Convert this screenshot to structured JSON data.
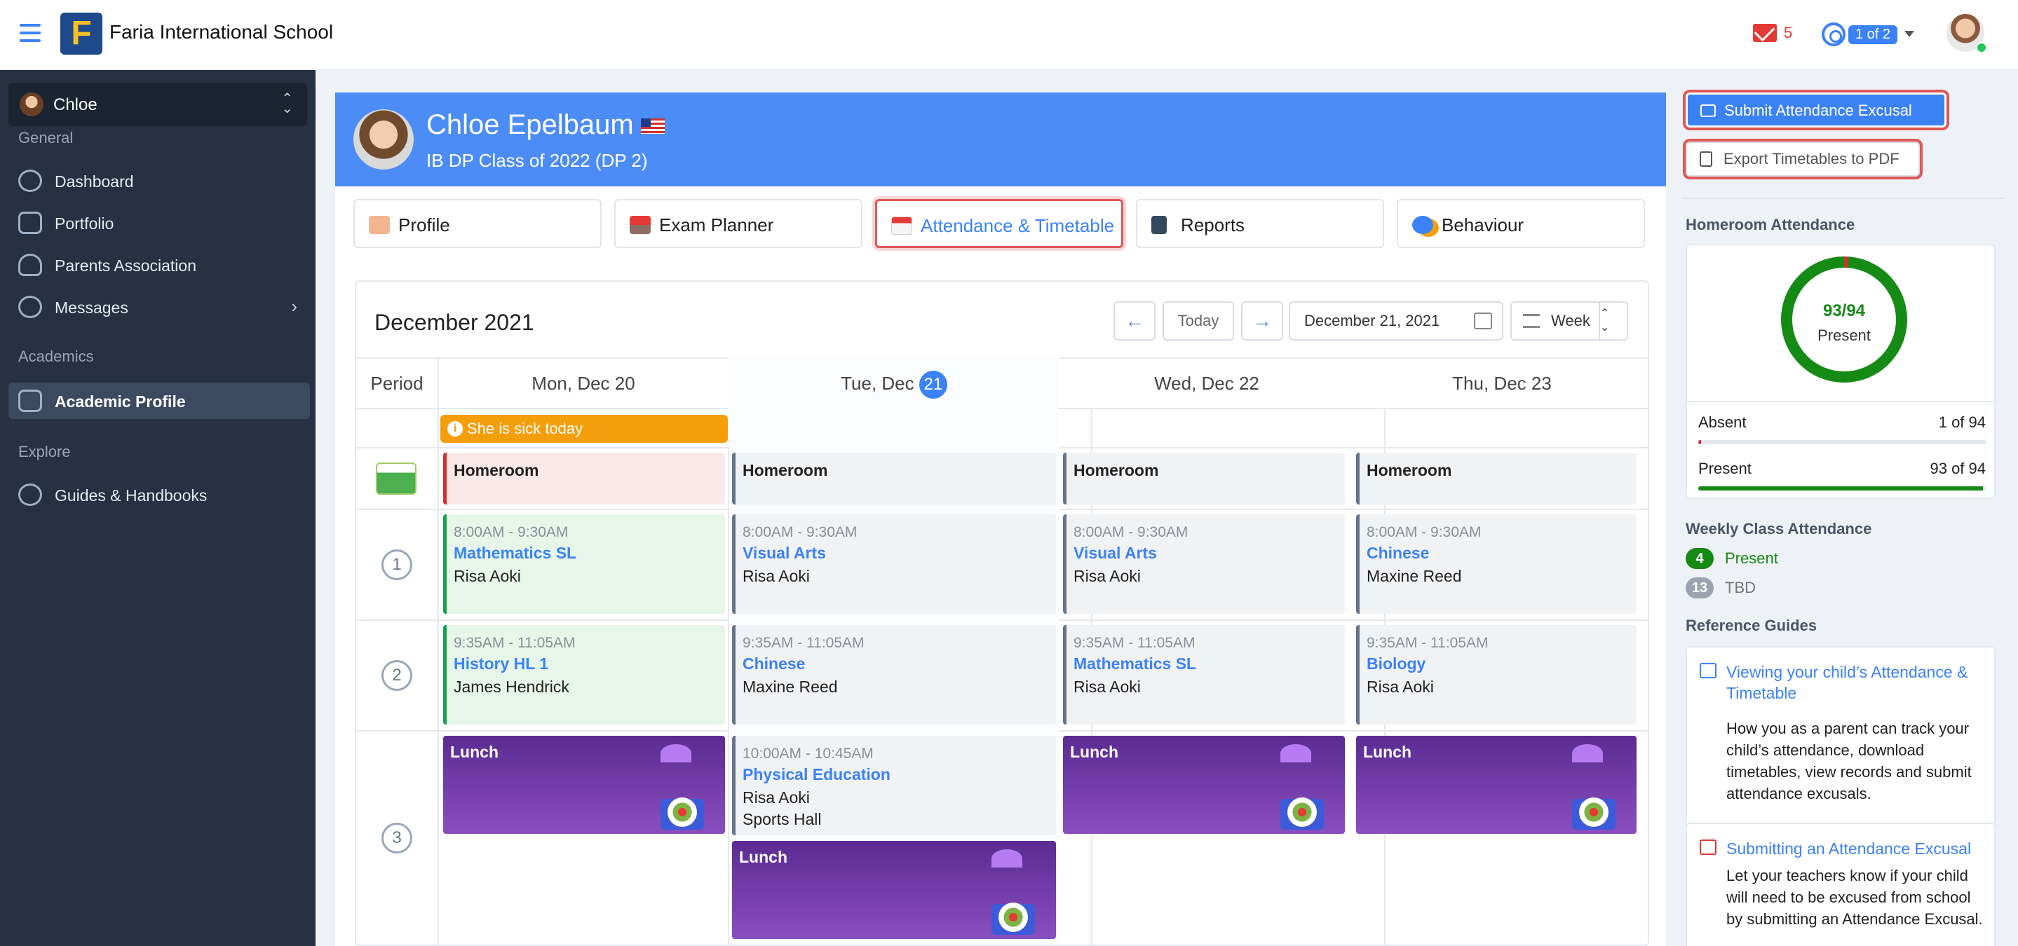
{
  "topbar": {
    "school_name": "Faria International School",
    "logo_letter": "F",
    "mail_count": "5",
    "help_pager": "1 of 2"
  },
  "sidebar": {
    "child_name": "Chloe",
    "sections": {
      "general": "General",
      "academics": "Academics",
      "explore": "Explore"
    },
    "items": [
      {
        "label": "Dashboard",
        "icon": "dashboard-icon"
      },
      {
        "label": "Portfolio",
        "icon": "portfolio-icon"
      },
      {
        "label": "Parents Association",
        "icon": "users-icon"
      },
      {
        "label": "Messages",
        "icon": "chat-icon"
      },
      {
        "label": "Academic Profile",
        "icon": "document-icon"
      },
      {
        "label": "Guides & Handbooks",
        "icon": "guides-icon"
      }
    ]
  },
  "student": {
    "name": "Chloe Epelbaum",
    "class_label": "IB DP Class of 2022 (DP 2)"
  },
  "tabs": [
    {
      "label": "Profile"
    },
    {
      "label": "Exam Planner"
    },
    {
      "label": "Attendance & Timetable"
    },
    {
      "label": "Reports"
    },
    {
      "label": "Behaviour"
    }
  ],
  "calendar": {
    "month": "December 2021",
    "today_label": "Today",
    "date_value": "December 21, 2021",
    "view_label": "Week",
    "period_header": "Period",
    "days": [
      {
        "label": "Mon, Dec 20"
      },
      {
        "label": "Tue, Dec",
        "num": "21"
      },
      {
        "label": "Wed, Dec 22"
      },
      {
        "label": "Thu, Dec 23"
      }
    ],
    "alert": "She is sick today",
    "periods": [
      "1",
      "2",
      "3"
    ],
    "homeroom": "Homeroom",
    "lunch": "Lunch",
    "events": {
      "mon1": {
        "time": "8:00AM - 9:30AM",
        "subject": "Mathematics SL",
        "teacher": "Risa Aoki"
      },
      "tue1": {
        "time": "8:00AM - 9:30AM",
        "subject": "Visual Arts",
        "teacher": "Risa Aoki"
      },
      "wed1": {
        "time": "8:00AM - 9:30AM",
        "subject": "Visual Arts",
        "teacher": "Risa Aoki"
      },
      "thu1": {
        "time": "8:00AM - 9:30AM",
        "subject": "Chinese",
        "teacher": "Maxine Reed"
      },
      "mon2": {
        "time": "9:35AM - 11:05AM",
        "subject": "History HL 1",
        "teacher": "James Hendrick"
      },
      "tue2": {
        "time": "9:35AM - 11:05AM",
        "subject": "Chinese",
        "teacher": "Maxine Reed"
      },
      "wed2": {
        "time": "9:35AM - 11:05AM",
        "subject": "Mathematics SL",
        "teacher": "Risa Aoki"
      },
      "thu2": {
        "time": "9:35AM - 11:05AM",
        "subject": "Biology",
        "teacher": "Risa Aoki"
      },
      "tue3": {
        "time": "10:00AM - 10:45AM",
        "subject": "Physical Education",
        "teacher": "Risa Aoki",
        "room": "Sports Hall"
      }
    }
  },
  "right": {
    "submit_label": "Submit Attendance Excusal",
    "export_label": "Export Timetables to PDF",
    "homeroom_title": "Homeroom Attendance",
    "donut_value": "93/94",
    "donut_caption": "Present",
    "absent_label": "Absent",
    "absent_value": "1 of 94",
    "absent_fraction": 0.0106,
    "present_label": "Present",
    "present_value": "93 of 94",
    "present_fraction": 0.9894,
    "weekly_title": "Weekly Class Attendance",
    "weekly": [
      {
        "count": "4",
        "label": "Present",
        "color": "#158a15"
      },
      {
        "count": "13",
        "label": "TBD",
        "color": "#9ca3af"
      }
    ],
    "ref_title": "Reference Guides",
    "guides": [
      {
        "title": "Viewing your child’s Attendance & Timetable",
        "desc": "How you as a parent can track your child’s attendance, download timetables, view records and submit attendance excusals."
      },
      {
        "title": "Submitting an Attendance Excusal",
        "desc": "Let your teachers know if your child will need to be excused from school by submitting an Attendance Excusal."
      }
    ]
  },
  "colors": {
    "accent": "#3b82f6",
    "sidebar_bg": "#263143",
    "present_green": "#158a15",
    "absent_red": "#d32f2f",
    "alert_orange": "#f59e0b"
  }
}
